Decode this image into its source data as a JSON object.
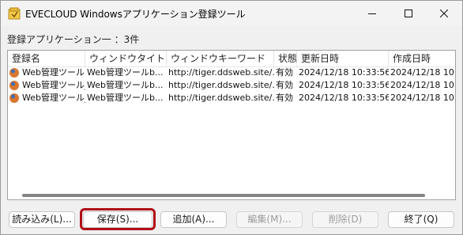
{
  "window": {
    "title": "EVECLOUD Windowsアプリケーション登録ツール",
    "controls": {
      "minimize_icon": "minimize-icon",
      "maximize_icon": "maximize-icon",
      "close_icon": "close-icon"
    }
  },
  "summary": "登録アプリケーション一 ：3件",
  "list": {
    "columns": [
      "登録名",
      "ウィンドウタイトル",
      "ウィンドウキーワード",
      "状態",
      "更新日時",
      "作成日時"
    ],
    "rows": [
      [
        "Web管理ツール",
        "Web管理ツールb...",
        "http://tiger.ddsweb.site/...",
        "有効",
        "2024/12/18 10:33:56",
        "2024/12/18 10:"
      ],
      [
        "Web管理ツール_",
        "Web管理ツールb...",
        "http://tiger.ddsweb.site/...",
        "有効",
        "2024/12/18 10:33:56",
        "2024/12/18 10:"
      ],
      [
        "Web管理ツール_",
        "Web管理ツールb...",
        "http://tiger.ddsweb.site/...",
        "有効",
        "2024/12/18 10:33:56",
        "2024/12/18 10:"
      ]
    ]
  },
  "buttons": {
    "load": "読み込み(L)...",
    "save": "保存(S)...",
    "add": "追加(A)...",
    "edit": "編集(M)...",
    "delete": "削除(D)",
    "exit": "終了(Q)"
  },
  "colors": {
    "highlight": "#b01016",
    "scroll_thumb": "#858585"
  }
}
